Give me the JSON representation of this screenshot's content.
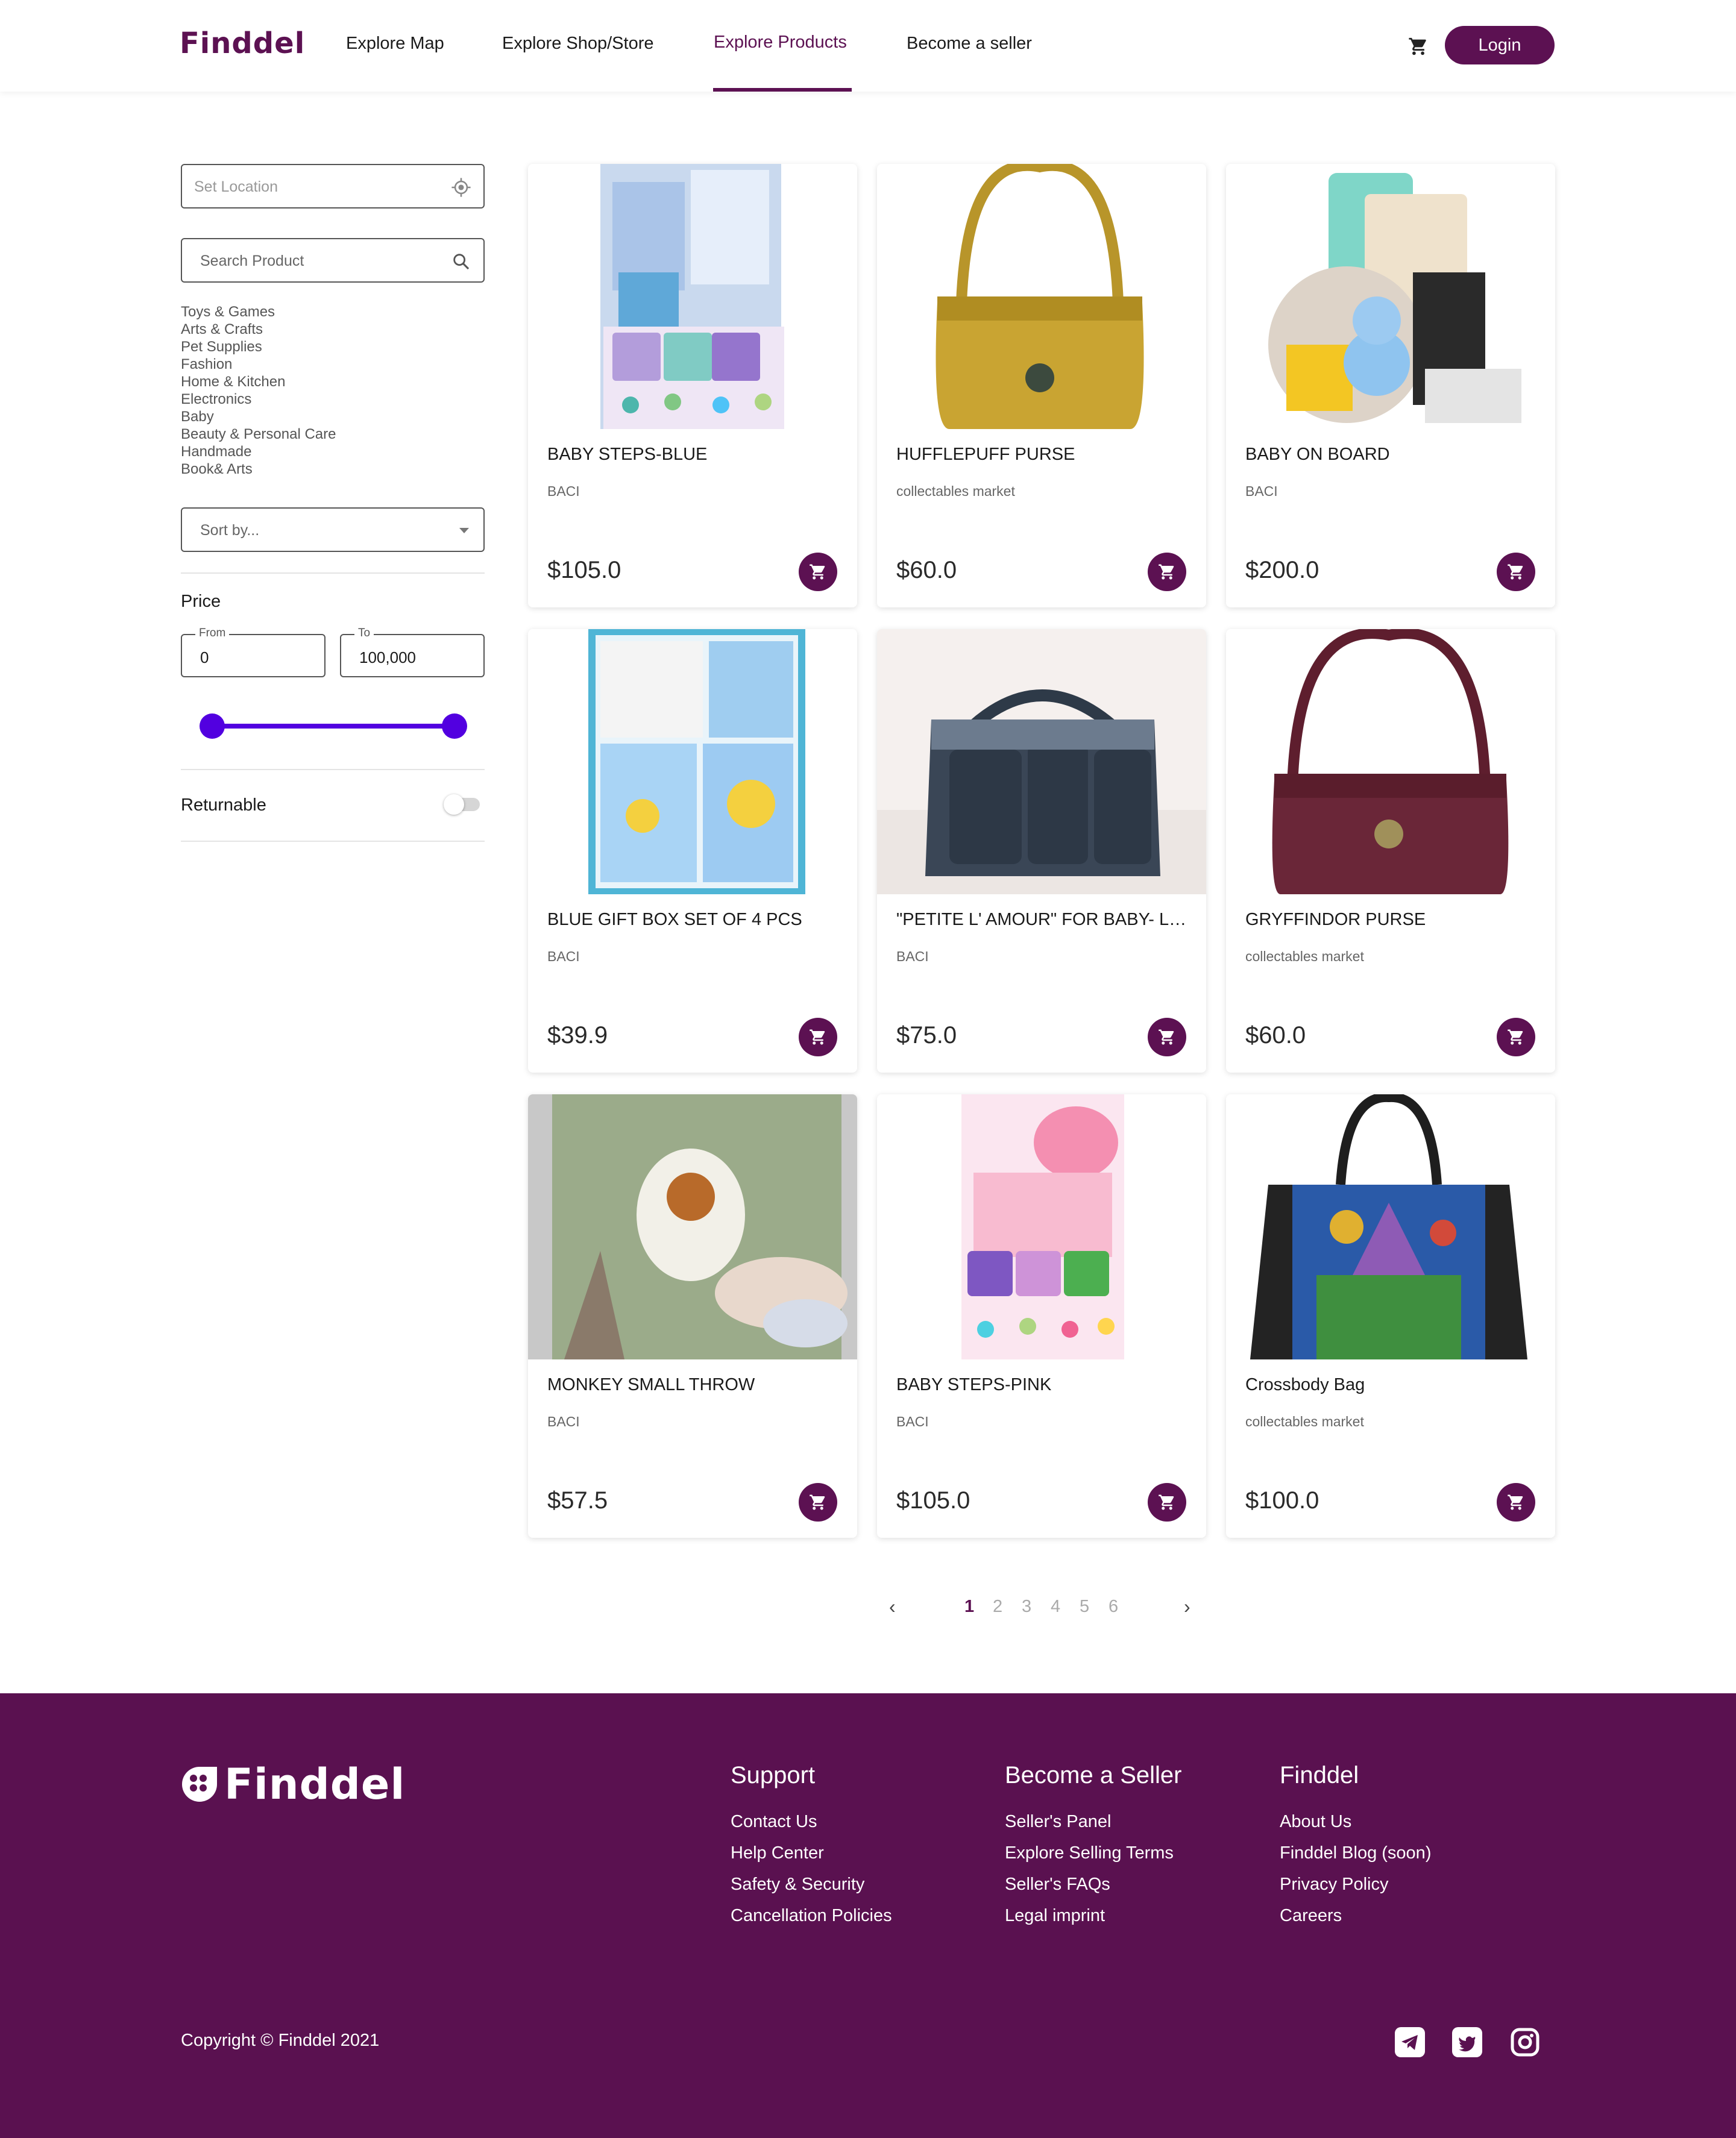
{
  "nav": {
    "logo": "Finddel",
    "links": [
      "Explore Map",
      "Explore Shop/Store",
      "Explore Products",
      "Become a seller"
    ],
    "active_link": "Explore Products",
    "login_label": "Login",
    "cart_icon": "cart-icon"
  },
  "sidebar": {
    "location_placeholder": "Set Location",
    "search_placeholder": "Search Product",
    "categories": [
      "Toys & Games",
      "Arts & Crafts",
      "Pet Supplies",
      "Fashion",
      "Home & Kitchen",
      "Electronics",
      "Baby",
      "Beauty & Personal Care",
      "Handmade",
      "Book& Arts"
    ],
    "sort_placeholder": "Sort by...",
    "price_label": "Price",
    "from_label": "From",
    "from_value": "0",
    "to_label": "To",
    "to_value": "100,000",
    "slider_range": [
      0,
      1
    ],
    "returnable_label": "Returnable",
    "returnable_on": false
  },
  "products": [
    {
      "name": "BABY STEPS-BLUE",
      "shop": "BACI",
      "price": "$105.0"
    },
    {
      "name": "HUFFLEPUFF PURSE",
      "shop": "collectables market",
      "price": "$60.0"
    },
    {
      "name": "BABY ON BOARD",
      "shop": "BACI",
      "price": "$200.0"
    },
    {
      "name": "BLUE GIFT BOX SET OF 4 PCS",
      "shop": "BACI",
      "price": "$39.9"
    },
    {
      "name": "\"PETITE L' AMOUR\" FOR BABY- LA...",
      "shop": "BACI",
      "price": "$75.0"
    },
    {
      "name": "GRYFFINDOR PURSE",
      "shop": "collectables market",
      "price": "$60.0"
    },
    {
      "name": "MONKEY SMALL THROW",
      "shop": "BACI",
      "price": "$57.5"
    },
    {
      "name": "BABY STEPS-PINK",
      "shop": "BACI",
      "price": "$105.0"
    },
    {
      "name": "Crossbody Bag",
      "shop": "collectables market",
      "price": "$100.0"
    }
  ],
  "pagination": {
    "pages": [
      "1",
      "2",
      "3",
      "4",
      "5",
      "6"
    ],
    "current": "1",
    "prev": "‹",
    "next": "›"
  },
  "footer": {
    "logo": "Finddel",
    "columns": [
      {
        "title": "Support",
        "links": [
          "Contact Us",
          "Help Center",
          "Safety & Security",
          "Cancellation Policies"
        ]
      },
      {
        "title": "Become a Seller",
        "links": [
          "Seller's Panel",
          "Explore Selling Terms",
          "Seller's FAQs",
          "Legal imprint"
        ]
      },
      {
        "title": "Finddel",
        "links": [
          "About Us",
          "Finddel Blog (soon)",
          "Privacy Policy",
          "Careers"
        ]
      }
    ],
    "copyright": "Copyright © Finddel 2021",
    "social_icons": [
      "telegram-icon",
      "twitter-icon",
      "instagram-icon"
    ]
  },
  "colors": {
    "brand": "#5c1152",
    "footer_bg": "#5a1150",
    "slider": "#5200e0"
  }
}
